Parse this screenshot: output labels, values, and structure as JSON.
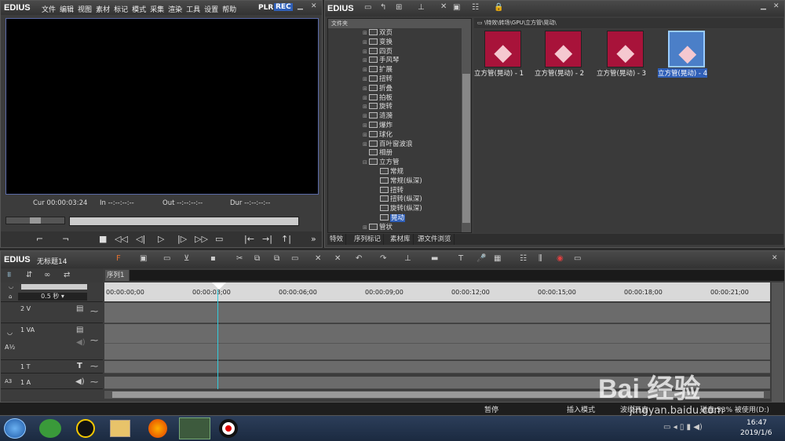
{
  "player": {
    "logo": "EDIUS",
    "menu": [
      "文件",
      "编辑",
      "视图",
      "素材",
      "标记",
      "模式",
      "采集",
      "渲染",
      "工具",
      "设置",
      "帮助"
    ],
    "plr": "PLR",
    "rec": "REC",
    "cur_label": "Cur",
    "cur": "00:00:03:24",
    "in_label": "In",
    "in": "--:--:--:--",
    "out_label": "Out",
    "out": "--:--:--:--",
    "dur_label": "Dur",
    "dur": "--:--:--:--"
  },
  "bin": {
    "logo": "EDIUS",
    "folder_header": "文件夹",
    "path": "\\特效\\转场\\GPU\\立方管\\晃动\\",
    "tree": [
      {
        "label": "双页",
        "indent": 1,
        "exp": "+"
      },
      {
        "label": "变换",
        "indent": 1,
        "exp": "+"
      },
      {
        "label": "四页",
        "indent": 1,
        "exp": "+"
      },
      {
        "label": "手风琴",
        "indent": 1,
        "exp": "+"
      },
      {
        "label": "扩展",
        "indent": 1,
        "exp": "+"
      },
      {
        "label": "扭转",
        "indent": 1,
        "exp": "+"
      },
      {
        "label": "折叠",
        "indent": 1,
        "exp": "+"
      },
      {
        "label": "拍板",
        "indent": 1,
        "exp": "+"
      },
      {
        "label": "旋转",
        "indent": 1,
        "exp": "+"
      },
      {
        "label": "涟漪",
        "indent": 1,
        "exp": "+"
      },
      {
        "label": "爆炸",
        "indent": 1,
        "exp": "+"
      },
      {
        "label": "球化",
        "indent": 1,
        "exp": "+"
      },
      {
        "label": "百叶窗波浪",
        "indent": 1,
        "exp": "+"
      },
      {
        "label": "相册",
        "indent": 1,
        "exp": ""
      },
      {
        "label": "立方管",
        "indent": 1,
        "exp": "-"
      },
      {
        "label": "常规",
        "indent": 2,
        "exp": ""
      },
      {
        "label": "常规(纵深)",
        "indent": 2,
        "exp": ""
      },
      {
        "label": "扭转",
        "indent": 2,
        "exp": ""
      },
      {
        "label": "扭转(纵深)",
        "indent": 2,
        "exp": ""
      },
      {
        "label": "旋转(纵深)",
        "indent": 2,
        "exp": ""
      },
      {
        "label": "晃动",
        "indent": 2,
        "exp": "",
        "selected": true
      },
      {
        "label": "管状",
        "indent": 1,
        "exp": "+"
      }
    ],
    "tabs": [
      "特效",
      "序列标记",
      "素材库",
      "源文件浏览"
    ],
    "items": [
      {
        "label": "立方管(晃动) - 1"
      },
      {
        "label": "立方管(晃动) - 2"
      },
      {
        "label": "立方管(晃动) - 3"
      },
      {
        "label": "立方管(晃动) - 4",
        "selected": true
      }
    ]
  },
  "timeline": {
    "logo": "EDIUS",
    "project": "无标题14",
    "sequence_tab": "序列1",
    "zoom": "0.5 秒",
    "ruler": [
      "00:00:00;00",
      "00:00:03;00",
      "00:00:06;00",
      "00:00:09;00",
      "00:00:12;00",
      "00:00:15;00",
      "00:00:18;00",
      "00:00:21;00"
    ],
    "tracks": [
      {
        "name": "2 V",
        "type": "video"
      },
      {
        "name": "1 VA",
        "type": "va"
      },
      {
        "name": "1 T",
        "type": "title"
      },
      {
        "name": "1 A",
        "type": "audio"
      }
    ],
    "status": {
      "pause": "暂停",
      "insert": "插入模式",
      "ripple": "波纹开启",
      "disk": "磁盘:53% 被使用(D:)"
    }
  },
  "taskbar": {
    "time": "16:47",
    "date": "2019/1/6"
  },
  "watermark": {
    "text": "Bai 经验",
    "url": "jingyan.baidu.com"
  },
  "colors": {
    "accent": "#3a64c8",
    "thumb": "#a8133a",
    "selected": "#2f5fb8"
  }
}
